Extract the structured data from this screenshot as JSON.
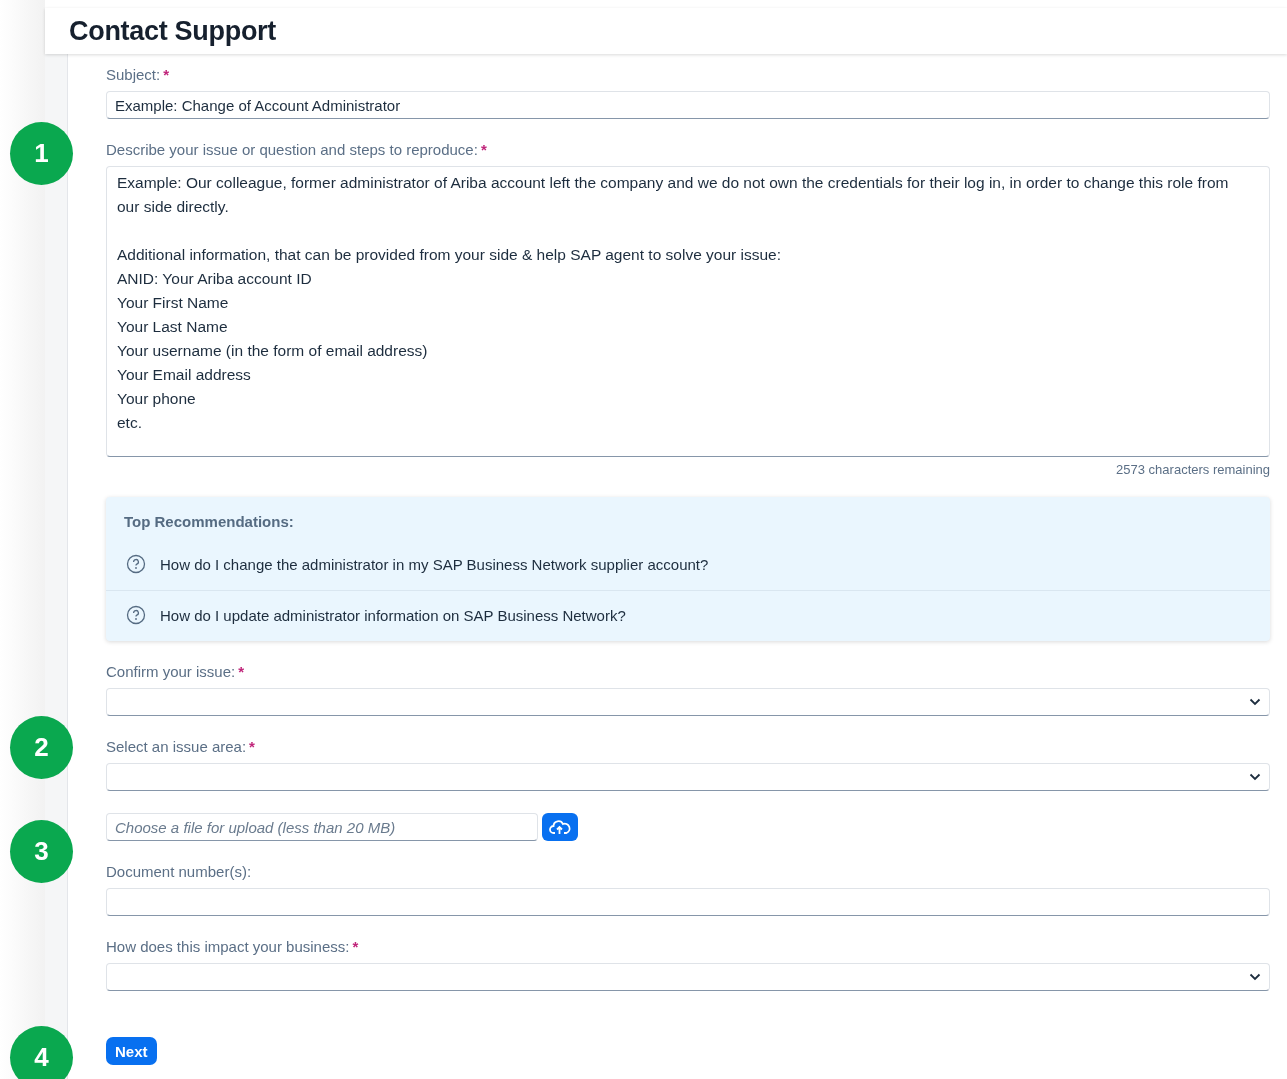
{
  "title": "Contact Support",
  "fields": [
    {
      "kind": "text",
      "label": "Subject:",
      "required_mark": "*",
      "value": "Example: Change of Account Administrator"
    },
    {
      "kind": "textarea",
      "label": "Describe your issue or question and steps to reproduce:",
      "required_mark": "*",
      "value": "Example: Our colleague, former administrator of Ariba account left the company and we do not own the credentials for their log in, in order to change this role from our side directly.\n\nAdditional information, that can be provided from your side & help SAP agent to solve your issue:\nANID: Your Ariba account ID\nYour First Name\nYour Last Name\nYour username (in the form of email address)\nYour Email address\nYour phone\netc.",
      "counter": "2573 characters remaining"
    },
    {
      "kind": "recommendations",
      "title": "Top Recommendations:",
      "items": [
        "How do I change the administrator in my SAP Business Network supplier account?",
        "How do I update administrator information on SAP Business Network?"
      ]
    },
    {
      "kind": "select",
      "label": "Confirm your issue:",
      "required_mark": "*"
    },
    {
      "kind": "select",
      "label": "Select an issue area:",
      "required_mark": "*"
    },
    {
      "kind": "file",
      "placeholder": "Choose a file for upload (less than 20 MB)"
    },
    {
      "kind": "text",
      "label": "Document number(s):"
    },
    {
      "kind": "select",
      "label": "How does this impact your business:",
      "required_mark": "*"
    }
  ],
  "next_button": "Next",
  "step_markers": [
    "1",
    "2",
    "3",
    "4"
  ]
}
